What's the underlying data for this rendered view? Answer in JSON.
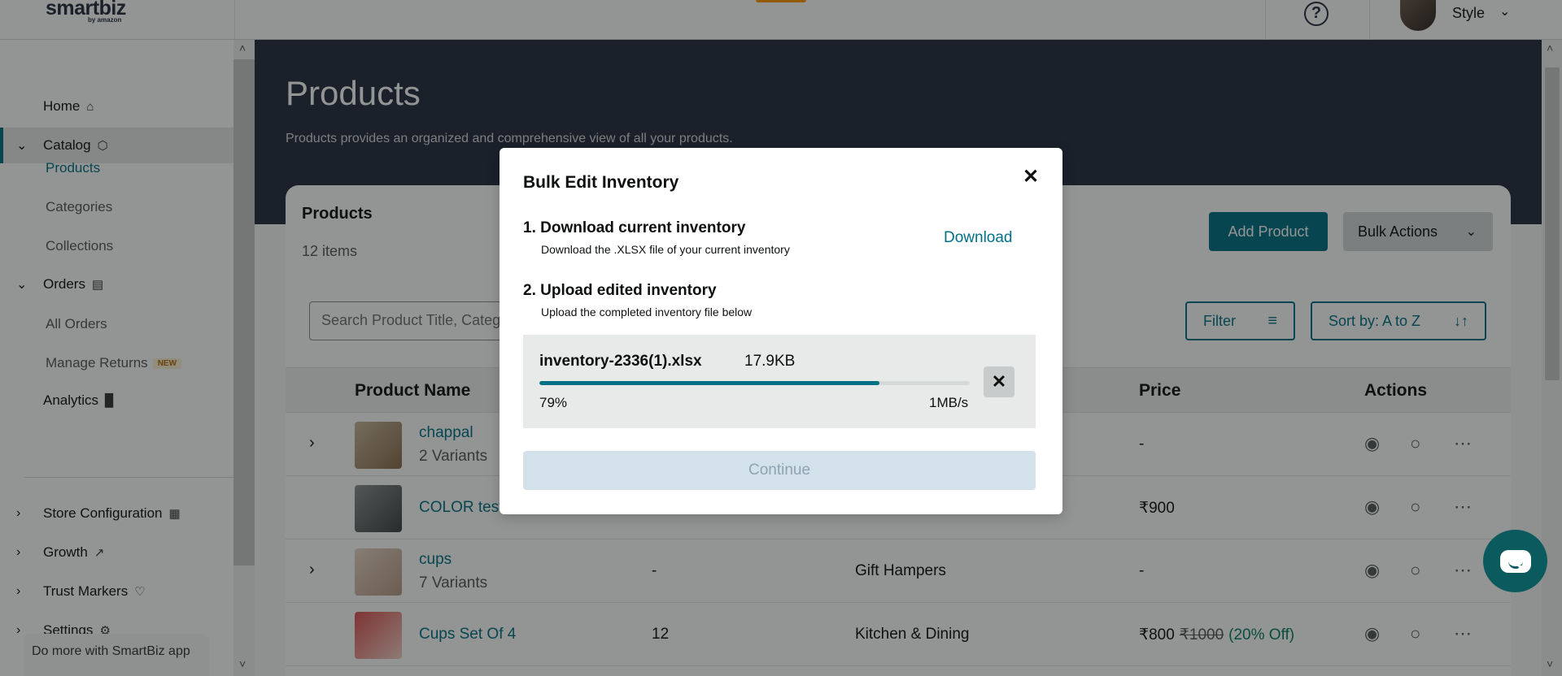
{
  "header": {
    "logo_word_a": "smart",
    "logo_word_b": "biz",
    "logo_by": "by amazon",
    "help_glyph": "?",
    "user_label": "Style"
  },
  "sidebar": {
    "items": [
      {
        "label": "Home",
        "icon": "home-icon"
      },
      {
        "label": "Catalog",
        "icon": "box-icon"
      },
      {
        "label": "Orders",
        "icon": "clipboard-icon"
      },
      {
        "label": "Analytics",
        "icon": "bar-chart-icon"
      },
      {
        "label": "Store Configuration",
        "icon": "store-icon"
      },
      {
        "label": "Growth",
        "icon": "trend-up-icon"
      },
      {
        "label": "Trust Markers",
        "icon": "heart-shield-icon"
      },
      {
        "label": "Settings",
        "icon": "gear-icon"
      }
    ],
    "catalog_sub": [
      "Products",
      "Categories",
      "Collections"
    ],
    "orders_sub": [
      "All Orders",
      "Manage Returns"
    ],
    "new_badge": "NEW",
    "promo_text": "Do more with SmartBiz app"
  },
  "page": {
    "title": "Products",
    "subtitle": "Products provides an organized and comprehensive view of all your products."
  },
  "card": {
    "title": "Products",
    "count": "12 items",
    "add_product": "Add Product",
    "bulk_actions": "Bulk Actions",
    "search_placeholder": "Search Product Title, Category",
    "filter": "Filter",
    "sort": "Sort by: A to Z"
  },
  "table": {
    "headers": {
      "name": "Product Name",
      "price": "Price",
      "actions": "Actions"
    },
    "rows": [
      {
        "name": "chappal",
        "variants": "2 Variants",
        "qty": "",
        "category": "",
        "price": "-",
        "expandable": true
      },
      {
        "name": "COLOR test",
        "variants": "",
        "qty": "",
        "category": "",
        "price": "₹900",
        "expandable": false
      },
      {
        "name": "cups",
        "variants": "7 Variants",
        "qty": "-",
        "category": "Gift Hampers",
        "price": "-",
        "expandable": true
      },
      {
        "name": "Cups Set Of 4",
        "variants": "",
        "qty": "12",
        "category": "Kitchen & Dining",
        "price": "₹800",
        "strike_price": "₹1000",
        "discount": "(20% Off)",
        "expandable": false
      }
    ]
  },
  "modal": {
    "title": "Bulk Edit Inventory",
    "step1_title": "1. Download current inventory",
    "step1_desc": "Download the .XLSX file of your current inventory",
    "download_label": "Download",
    "step2_title": "2. Upload edited inventory",
    "step2_desc": "Upload the completed inventory file below",
    "file_name": "inventory-2336(1).xlsx",
    "file_size": "17.9KB",
    "progress_percent": 79,
    "progress_label": "79%",
    "speed": "1MB/s",
    "continue_label": "Continue"
  },
  "colors": {
    "accent": "#007185",
    "hero_bg": "#232f3e",
    "discount": "#067d62",
    "chat": "#0b5a5e"
  }
}
